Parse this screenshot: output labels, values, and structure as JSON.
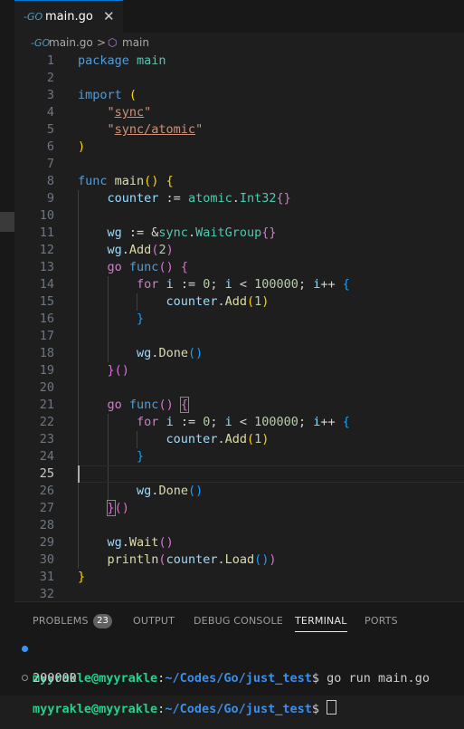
{
  "tab": {
    "icon": "-GO",
    "filename": "main.go",
    "close": "✕"
  },
  "breadcrumb": {
    "icon": "-GO",
    "file": "main.go",
    "sep": ">",
    "symbol_icon": "⬡",
    "symbol": "main"
  },
  "editor": {
    "current_line": 25,
    "lines": [
      {
        "n": "1",
        "tokens": [
          [
            "kw",
            "package"
          ],
          [
            "op",
            " "
          ],
          [
            "pkg",
            "main"
          ]
        ]
      },
      {
        "n": "2",
        "tokens": []
      },
      {
        "n": "3",
        "tokens": [
          [
            "kw",
            "import"
          ],
          [
            "op",
            " "
          ],
          [
            "b1",
            "("
          ]
        ]
      },
      {
        "n": "4",
        "tokens": [
          [
            "op",
            "    "
          ],
          [
            "str",
            "\""
          ],
          [
            "str ul",
            "sync"
          ],
          [
            "str",
            "\""
          ]
        ]
      },
      {
        "n": "5",
        "tokens": [
          [
            "op",
            "    "
          ],
          [
            "str",
            "\""
          ],
          [
            "str ul",
            "sync/atomic"
          ],
          [
            "str",
            "\""
          ]
        ]
      },
      {
        "n": "6",
        "tokens": [
          [
            "b1",
            ")"
          ]
        ]
      },
      {
        "n": "7",
        "tokens": []
      },
      {
        "n": "8",
        "tokens": [
          [
            "kw",
            "func"
          ],
          [
            "op",
            " "
          ],
          [
            "fn",
            "main"
          ],
          [
            "b1",
            "()"
          ],
          [
            "op",
            " "
          ],
          [
            "b1",
            "{"
          ]
        ]
      },
      {
        "n": "9",
        "tokens": [
          [
            "op",
            "    "
          ],
          [
            "var",
            "counter"
          ],
          [
            "op",
            " := "
          ],
          [
            "pkg",
            "atomic"
          ],
          [
            "op",
            "."
          ],
          [
            "pkg",
            "Int32"
          ],
          [
            "b2",
            "{}"
          ]
        ]
      },
      {
        "n": "10",
        "tokens": []
      },
      {
        "n": "11",
        "tokens": [
          [
            "op",
            "    "
          ],
          [
            "var",
            "wg"
          ],
          [
            "op",
            " := &"
          ],
          [
            "pkg",
            "sync"
          ],
          [
            "op",
            "."
          ],
          [
            "pkg",
            "WaitGroup"
          ],
          [
            "b2",
            "{}"
          ]
        ]
      },
      {
        "n": "12",
        "tokens": [
          [
            "op",
            "    "
          ],
          [
            "var",
            "wg"
          ],
          [
            "op",
            "."
          ],
          [
            "fn",
            "Add"
          ],
          [
            "b2",
            "("
          ],
          [
            "num",
            "2"
          ],
          [
            "b2",
            ")"
          ]
        ]
      },
      {
        "n": "13",
        "tokens": [
          [
            "op",
            "    "
          ],
          [
            "ctl",
            "go"
          ],
          [
            "op",
            " "
          ],
          [
            "kw",
            "func"
          ],
          [
            "b2",
            "()"
          ],
          [
            "op",
            " "
          ],
          [
            "b2",
            "{"
          ]
        ]
      },
      {
        "n": "14",
        "tokens": [
          [
            "op",
            "        "
          ],
          [
            "ctl",
            "for"
          ],
          [
            "op",
            " "
          ],
          [
            "var",
            "i"
          ],
          [
            "op",
            " := "
          ],
          [
            "num",
            "0"
          ],
          [
            "op",
            "; "
          ],
          [
            "var",
            "i"
          ],
          [
            "op",
            " < "
          ],
          [
            "num",
            "100000"
          ],
          [
            "op",
            "; "
          ],
          [
            "var",
            "i"
          ],
          [
            "op",
            "++ "
          ],
          [
            "b3",
            "{"
          ]
        ]
      },
      {
        "n": "15",
        "tokens": [
          [
            "op",
            "            "
          ],
          [
            "var",
            "counter"
          ],
          [
            "op",
            "."
          ],
          [
            "fn",
            "Add"
          ],
          [
            "b1",
            "("
          ],
          [
            "num",
            "1"
          ],
          [
            "b1",
            ")"
          ]
        ]
      },
      {
        "n": "16",
        "tokens": [
          [
            "op",
            "        "
          ],
          [
            "b3",
            "}"
          ]
        ]
      },
      {
        "n": "17",
        "tokens": []
      },
      {
        "n": "18",
        "tokens": [
          [
            "op",
            "        "
          ],
          [
            "var",
            "wg"
          ],
          [
            "op",
            "."
          ],
          [
            "fn",
            "Done"
          ],
          [
            "b3",
            "()"
          ]
        ]
      },
      {
        "n": "19",
        "tokens": [
          [
            "op",
            "    "
          ],
          [
            "b2",
            "}"
          ],
          [
            "b2",
            "()"
          ]
        ]
      },
      {
        "n": "20",
        "tokens": []
      },
      {
        "n": "21",
        "tokens": [
          [
            "op",
            "    "
          ],
          [
            "ctl",
            "go"
          ],
          [
            "op",
            " "
          ],
          [
            "kw",
            "func"
          ],
          [
            "b2",
            "()"
          ],
          [
            "op",
            " "
          ],
          [
            "b2 bm",
            "{"
          ]
        ]
      },
      {
        "n": "22",
        "tokens": [
          [
            "op",
            "        "
          ],
          [
            "ctl",
            "for"
          ],
          [
            "op",
            " "
          ],
          [
            "var",
            "i"
          ],
          [
            "op",
            " := "
          ],
          [
            "num",
            "0"
          ],
          [
            "op",
            "; "
          ],
          [
            "var",
            "i"
          ],
          [
            "op",
            " < "
          ],
          [
            "num",
            "100000"
          ],
          [
            "op",
            "; "
          ],
          [
            "var",
            "i"
          ],
          [
            "op",
            "++ "
          ],
          [
            "b3",
            "{"
          ]
        ]
      },
      {
        "n": "23",
        "tokens": [
          [
            "op",
            "            "
          ],
          [
            "var",
            "counter"
          ],
          [
            "op",
            "."
          ],
          [
            "fn",
            "Add"
          ],
          [
            "b1",
            "("
          ],
          [
            "num",
            "1"
          ],
          [
            "b1",
            ")"
          ]
        ]
      },
      {
        "n": "24",
        "tokens": [
          [
            "op",
            "        "
          ],
          [
            "b3",
            "}"
          ]
        ]
      },
      {
        "n": "25",
        "tokens": []
      },
      {
        "n": "26",
        "tokens": [
          [
            "op",
            "        "
          ],
          [
            "var",
            "wg"
          ],
          [
            "op",
            "."
          ],
          [
            "fn",
            "Done"
          ],
          [
            "b3",
            "()"
          ]
        ]
      },
      {
        "n": "27",
        "tokens": [
          [
            "op",
            "    "
          ],
          [
            "b2 bm",
            "}"
          ],
          [
            "b2",
            "()"
          ]
        ]
      },
      {
        "n": "28",
        "tokens": []
      },
      {
        "n": "29",
        "tokens": [
          [
            "op",
            "    "
          ],
          [
            "var",
            "wg"
          ],
          [
            "op",
            "."
          ],
          [
            "fn",
            "Wait"
          ],
          [
            "b2",
            "()"
          ]
        ]
      },
      {
        "n": "30",
        "tokens": [
          [
            "op",
            "    "
          ],
          [
            "fn",
            "println"
          ],
          [
            "b2",
            "("
          ],
          [
            "var",
            "counter"
          ],
          [
            "op",
            "."
          ],
          [
            "fn",
            "Load"
          ],
          [
            "b3",
            "()"
          ],
          [
            "b2",
            ")"
          ]
        ]
      },
      {
        "n": "31",
        "tokens": [
          [
            "b1",
            "}"
          ]
        ]
      },
      {
        "n": "32",
        "tokens": []
      }
    ]
  },
  "panel": {
    "tabs": [
      "PROBLEMS",
      "OUTPUT",
      "DEBUG CONSOLE",
      "TERMINAL",
      "PORTS"
    ],
    "active_tab": "TERMINAL",
    "problems_count": "23"
  },
  "terminal": {
    "user": "myyrakle@myyrakle",
    "path": "~/Codes/Go/just_test",
    "prompt": "$",
    "command": "go run main.go",
    "output": "200000"
  },
  "colors": {
    "accent": "#0078d4",
    "background": "#1e1e1e",
    "panel": "#181818"
  }
}
